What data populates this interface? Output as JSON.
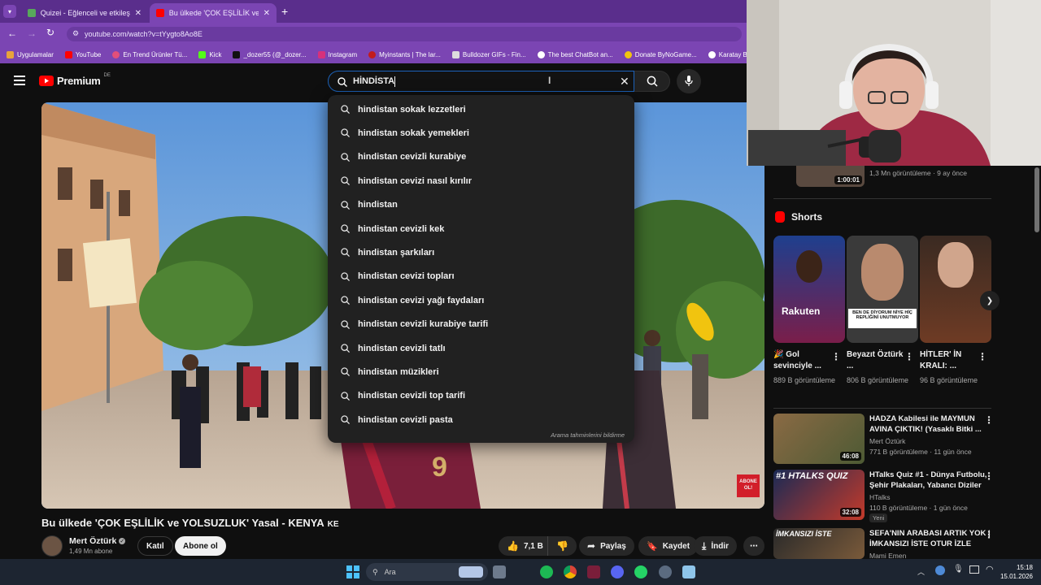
{
  "browser": {
    "tabs": [
      {
        "title": "Quizei - Eğlenceli ve etkileşimli",
        "active": false
      },
      {
        "title": "Bu ülkede 'ÇOK EŞLİLİK ve YOL",
        "active": true
      }
    ],
    "url": "youtube.com/watch?v=tYygto8Ao8E",
    "bookmarks": [
      "Uygulamalar",
      "YouTube",
      "En Trend Ürünler Tü...",
      "Kick",
      "_dozer55 (@_dozer...",
      "Instagram",
      "Myinstants | The lar...",
      "Bulldozer GIFs - Fin...",
      "The best ChatBot an...",
      "Donate ByNoGame...",
      "Karatay Beledi"
    ]
  },
  "youtube": {
    "logo_text": "Premium",
    "logo_badge": "DE",
    "search_value": "HİNDİSTA",
    "suggestions": [
      "hindistan sokak lezzetleri",
      "hindistan sokak yemekleri",
      "hindistan cevizli kurabiye",
      "hindistan cevizi nasıl kırılır",
      "hindistan",
      "hindistan cevizli kek",
      "hindistan şarkıları",
      "hindistan cevizi topları",
      "hindistan cevizi yağı faydaları",
      "hindistan cevizli kurabiye tarifi",
      "hindistan cevizli tatlı",
      "hindistan müzikleri",
      "hindistan cevizli top tarifi",
      "hindistan cevizli pasta"
    ],
    "report_text": "Arama tahminlerini bildirme",
    "video": {
      "title": "Bu ülkede 'ÇOK EŞLİLİK ve YOLSUZLUK' Yasal - KENYA",
      "title_flag": "KE",
      "channel": "Mert Öztürk",
      "subscribers": "1,49 Mn abone",
      "join_label": "Katıl",
      "subscribe_label": "Abone ol",
      "likes": "7,1 B",
      "share_label": "Paylaş",
      "save_label": "Kaydet",
      "download_label": "İndir",
      "watermark": "ABONE OL!"
    },
    "sidebar": {
      "top_item": {
        "duration": "1:00:01",
        "meta": "1,3 Mn görüntüleme · 9 ay önce"
      },
      "shorts_heading": "Shorts",
      "shorts": [
        {
          "title": "🎉 Gol sevinciyle ...",
          "views": "889 B görüntüleme",
          "overlay": "Rakuten"
        },
        {
          "title": "Beyazıt Öztürk ...",
          "views": "806 B görüntüleme",
          "overlay": "BEN DE DİYORUM NİYE HİÇ REPLİĞİNİ UNUTMUYOR"
        },
        {
          "title": "HİTLER' İN KRALI: ...",
          "views": "96 B görüntüleme",
          "overlay": ""
        }
      ],
      "recommended": [
        {
          "title": "HADZA Kabilesi ile MAYMUN AVINA ÇIKTIK! (Yasaklı Bitki ...",
          "channel": "Mert Öztürk",
          "meta": "771 B görüntüleme · 11 gün önce",
          "duration": "46:08",
          "badge": ""
        },
        {
          "title": "HTalks Quiz #1 - Dünya Futbolu, Şehir Plakaları, Yabancı Diziler",
          "channel": "HTalks",
          "meta": "110 B görüntüleme · 1 gün önce",
          "duration": "32:08",
          "badge": "Yeni",
          "thumb_text": "#1 HTALKS QUIZ"
        },
        {
          "title": "SEFA'NIN ARABASI ARTIK YOK | İMKANSIZI İSTE OTUR İZLE",
          "channel": "Mami Emen",
          "meta": "",
          "duration": "",
          "badge": "",
          "thumb_text": "İMKANSIZI İSTE"
        }
      ]
    }
  },
  "taskbar": {
    "search_placeholder": "Ara",
    "time": "15:18",
    "date": "15.01.2026"
  },
  "colors": {
    "chrome_purple": "#7b45b3",
    "tab_strip": "#5a2e8c",
    "yt_red": "#ff0000",
    "search_focus": "#1c62b9"
  }
}
